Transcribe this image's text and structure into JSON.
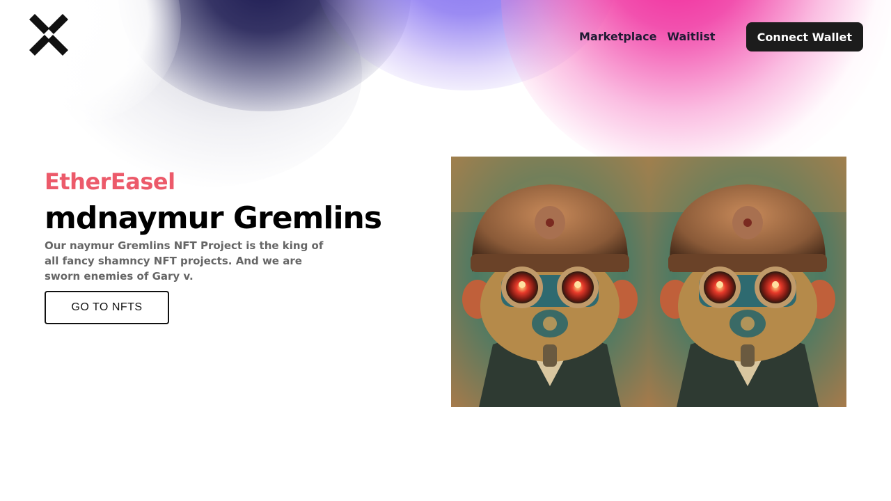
{
  "nav": {
    "links": [
      "Marketplace",
      "Waitlist"
    ],
    "connect_label": "Connect Wallet"
  },
  "hero": {
    "brand": "EtherEasel",
    "title": "mdnaymur Gremlins",
    "description": "Our naymur Gremlins NFT Project is the king of all fancy shamncy NFT projects. And we are sworn enemies of Gary v.",
    "cta_label": "GO TO NFTS"
  },
  "gallery": {
    "items": [
      {
        "alt": "steampunk gremlin robot",
        "icon": "robot-portrait"
      },
      {
        "alt": "steampunk gremlin robot",
        "icon": "robot-portrait"
      }
    ]
  },
  "colors": {
    "brand": "#ec5a6a",
    "button_dark": "#1c1c1c",
    "blob_navy": "#1a1850",
    "blob_purple": "#7c6af0",
    "blob_pink": "#f01e96"
  }
}
